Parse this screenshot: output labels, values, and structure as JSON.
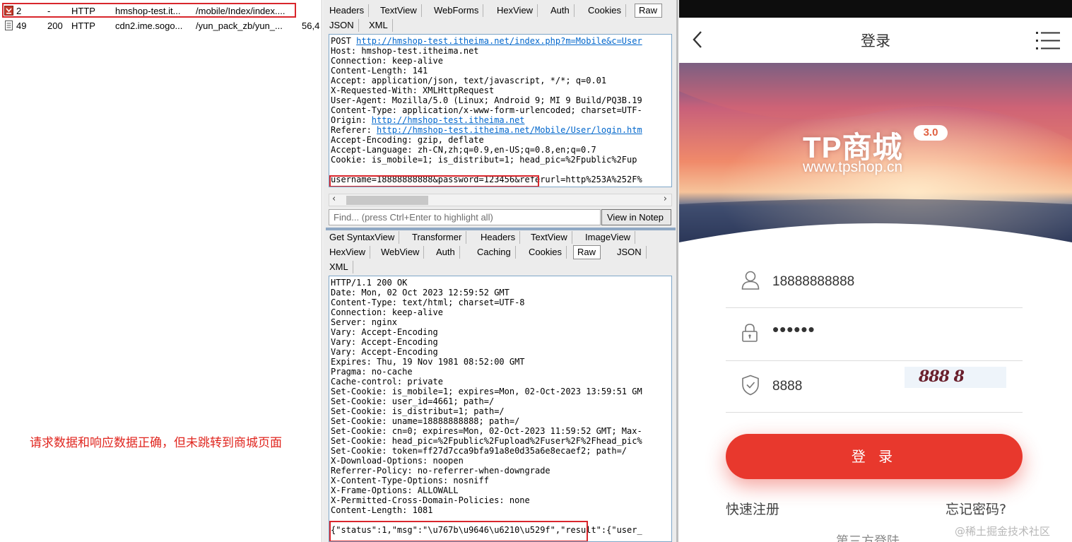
{
  "sessions": [
    {
      "num": "2",
      "result": "-",
      "protocol": "HTTP",
      "host": "hmshop-test.it...",
      "url": "/mobile/Index/index....",
      "body": "",
      "icon": "http-request-icon"
    },
    {
      "num": "49",
      "result": "200",
      "protocol": "HTTP",
      "host": "cdn2.ime.sogo...",
      "url": "/yun_pack_zb/yun_...",
      "body": "56,4",
      "icon": "document-icon"
    }
  ],
  "annotation": "请求数据和响应数据正确，但未跳转到商城页面",
  "request": {
    "tabs_row1": [
      "Headers",
      "TextView",
      "WebForms",
      "HexView",
      "Auth",
      "Cookies",
      "Raw"
    ],
    "tabs_row2": [
      "JSON",
      "XML"
    ],
    "active_tab": "Raw",
    "line_post_method": "POST ",
    "line_post_url": "http://hmshop-test.itheima.net/index.php?m=Mobile&c=User",
    "headers_block_1": "Host: hmshop-test.itheima.net\nConnection: keep-alive\nContent-Length: 141\nAccept: application/json, text/javascript, */*; q=0.01\nX-Requested-With: XMLHttpRequest\nUser-Agent: Mozilla/5.0 (Linux; Android 9; MI 9 Build/PQ3B.19\nContent-Type: application/x-www-form-urlencoded; charset=UTF-",
    "origin_label": "Origin: ",
    "origin_url": "http://hmshop-test.itheima.net",
    "referer_label": "Referer: ",
    "referer_url": "http://hmshop-test.itheima.net/Mobile/User/login.htm",
    "headers_block_2": "Accept-Encoding: gzip, deflate\nAccept-Language: zh-CN,zh;q=0.9,en-US;q=0.8,en;q=0.7\nCookie: is_mobile=1; is_distribut=1; head_pic=%2Fpublic%2Fup",
    "body": "username=18888888888&password=123456&referurl=http%253A%252F%"
  },
  "find": {
    "placeholder": "Find... (press Ctrl+Enter to highlight all)",
    "button": "View in Notep"
  },
  "response": {
    "tabs_row1": [
      "Get SyntaxView",
      "Transformer",
      "Headers",
      "TextView",
      "ImageView"
    ],
    "tabs_row2": [
      "HexView",
      "WebView",
      "Auth",
      "Caching",
      "Cookies",
      "Raw",
      "JSON"
    ],
    "tabs_row3": [
      "XML"
    ],
    "active_tab": "Raw",
    "headers": "HTTP/1.1 200 OK\nDate: Mon, 02 Oct 2023 12:59:52 GMT\nContent-Type: text/html; charset=UTF-8\nConnection: keep-alive\nServer: nginx\nVary: Accept-Encoding\nVary: Accept-Encoding\nVary: Accept-Encoding\nExpires: Thu, 19 Nov 1981 08:52:00 GMT\nPragma: no-cache\nCache-control: private\nSet-Cookie: is_mobile=1; expires=Mon, 02-Oct-2023 13:59:51 GM\nSet-Cookie: user_id=4661; path=/\nSet-Cookie: is_distribut=1; path=/\nSet-Cookie: uname=18888888888; path=/\nSet-Cookie: cn=0; expires=Mon, 02-Oct-2023 11:59:52 GMT; Max-\nSet-Cookie: head_pic=%2Fpublic%2Fupload%2Fuser%2F%2Fhead_pic%\nSet-Cookie: token=ff27d7cca9bfa91a8e0d35a6e8ecaef2; path=/\nX-Download-Options: noopen\nReferrer-Policy: no-referrer-when-downgrade\nX-Content-Type-Options: nosniff\nX-Frame-Options: ALLOWALL\nX-Permitted-Cross-Domain-Policies: none\nContent-Length: 1081",
    "body": "{\"status\":1,\"msg\":\"\\u767b\\u9646\\u6210\\u529f\",\"result\":{\"user_"
  },
  "phone": {
    "title": "登录",
    "brand": "TP商城",
    "version": "3.0",
    "brand_url": "www.tpshop.cn",
    "username": "18888888888",
    "password_mask": "••••••",
    "captcha_input": "8888",
    "captcha_image_text": "888 8",
    "login_button": "登 录",
    "register": "快速注册",
    "forgot": "忘记密码?",
    "third_party": "第三方登陆",
    "watermark": "@稀土掘金技术社区",
    "colors": {
      "primary": "#e8382d",
      "status_bar": "#0d0d0d"
    }
  }
}
